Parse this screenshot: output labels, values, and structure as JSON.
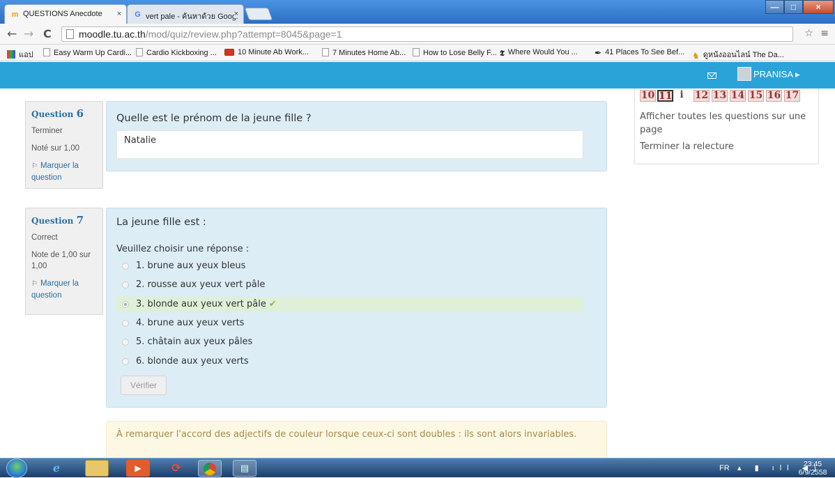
{
  "browser": {
    "tabs": [
      {
        "icon": "moodle-icon",
        "label": "QUESTIONS Anecdote",
        "close": "×"
      },
      {
        "icon": "google-icon",
        "label": "vert pale - ค้นหาด้วย Googl",
        "close": "×"
      }
    ],
    "window_buttons": [
      "—",
      "□",
      "×"
    ],
    "address": {
      "host": "moodle.tu.ac.th",
      "path": "/mod/quiz/review.php?attempt=8045&page=1"
    },
    "bookmarks": [
      {
        "icon": "apps-icon",
        "label": "แอป"
      },
      {
        "icon": "page-icon",
        "label": "Easy Warm Up Cardi..."
      },
      {
        "icon": "page-icon",
        "label": "Cardio Kickboxing ..."
      },
      {
        "icon": "youtube-icon",
        "label": "10 Minute Ab Work..."
      },
      {
        "icon": "page-icon",
        "label": "7 Minutes Home Ab..."
      },
      {
        "icon": "page-icon",
        "label": "How to Lose Belly F..."
      },
      {
        "icon": "nyt-icon",
        "label": "Where Would You ..."
      },
      {
        "icon": "feather-icon",
        "label": "41 Places To See Bef..."
      },
      {
        "icon": "bookmark-glyph-icon",
        "label": "ดูหนังออนไลน์ The Da..."
      }
    ]
  },
  "header": {
    "username": "PRANISA"
  },
  "questions": [
    {
      "label": "Question",
      "number": "6",
      "state": "Terminer",
      "grade": "Noté sur 1,00",
      "flag": "Marquer la question",
      "text": "Quelle est le prénom de la jeune fille ?",
      "answer": "Natalie"
    },
    {
      "label": "Question",
      "number": "7",
      "state": "Correct",
      "grade": "Note de 1,00 sur 1,00",
      "flag": "Marquer la question",
      "text": "La jeune fille est :",
      "prompt": "Veuillez choisir une réponse :",
      "options": [
        "1. brune aux yeux bleus",
        "2. rousse aux yeux vert pâle",
        "3. blonde aux yeux vert pâle",
        "4. brune aux yeux verts",
        "5. châtain aux yeux pâles",
        "6. blonde aux yeux verts"
      ],
      "selected_index": 2,
      "check_mark": "✔",
      "verify_label": "Vérifier",
      "feedback": "À remarquer l'accord des adjectifs de couleur lorsque ceux-ci sont doubles : ils sont alors invariables."
    }
  ],
  "quiz_nav": {
    "buttons": [
      "10",
      "11",
      "i",
      "12",
      "13",
      "14",
      "15",
      "16",
      "17"
    ],
    "current": "11",
    "show_all": "Afficher toutes les questions sur une page",
    "finish_review": "Terminer la relecture"
  },
  "taskbar": {
    "language": "FR",
    "time": "23:45",
    "date": "6/9/2558"
  },
  "colors": {
    "header": "#2aa3d8",
    "question_bg": "#dcedf6",
    "correct_bg": "#dff0d8",
    "feedback_bg": "#fcf8e3",
    "nav_incorrect": "#f2dede"
  }
}
